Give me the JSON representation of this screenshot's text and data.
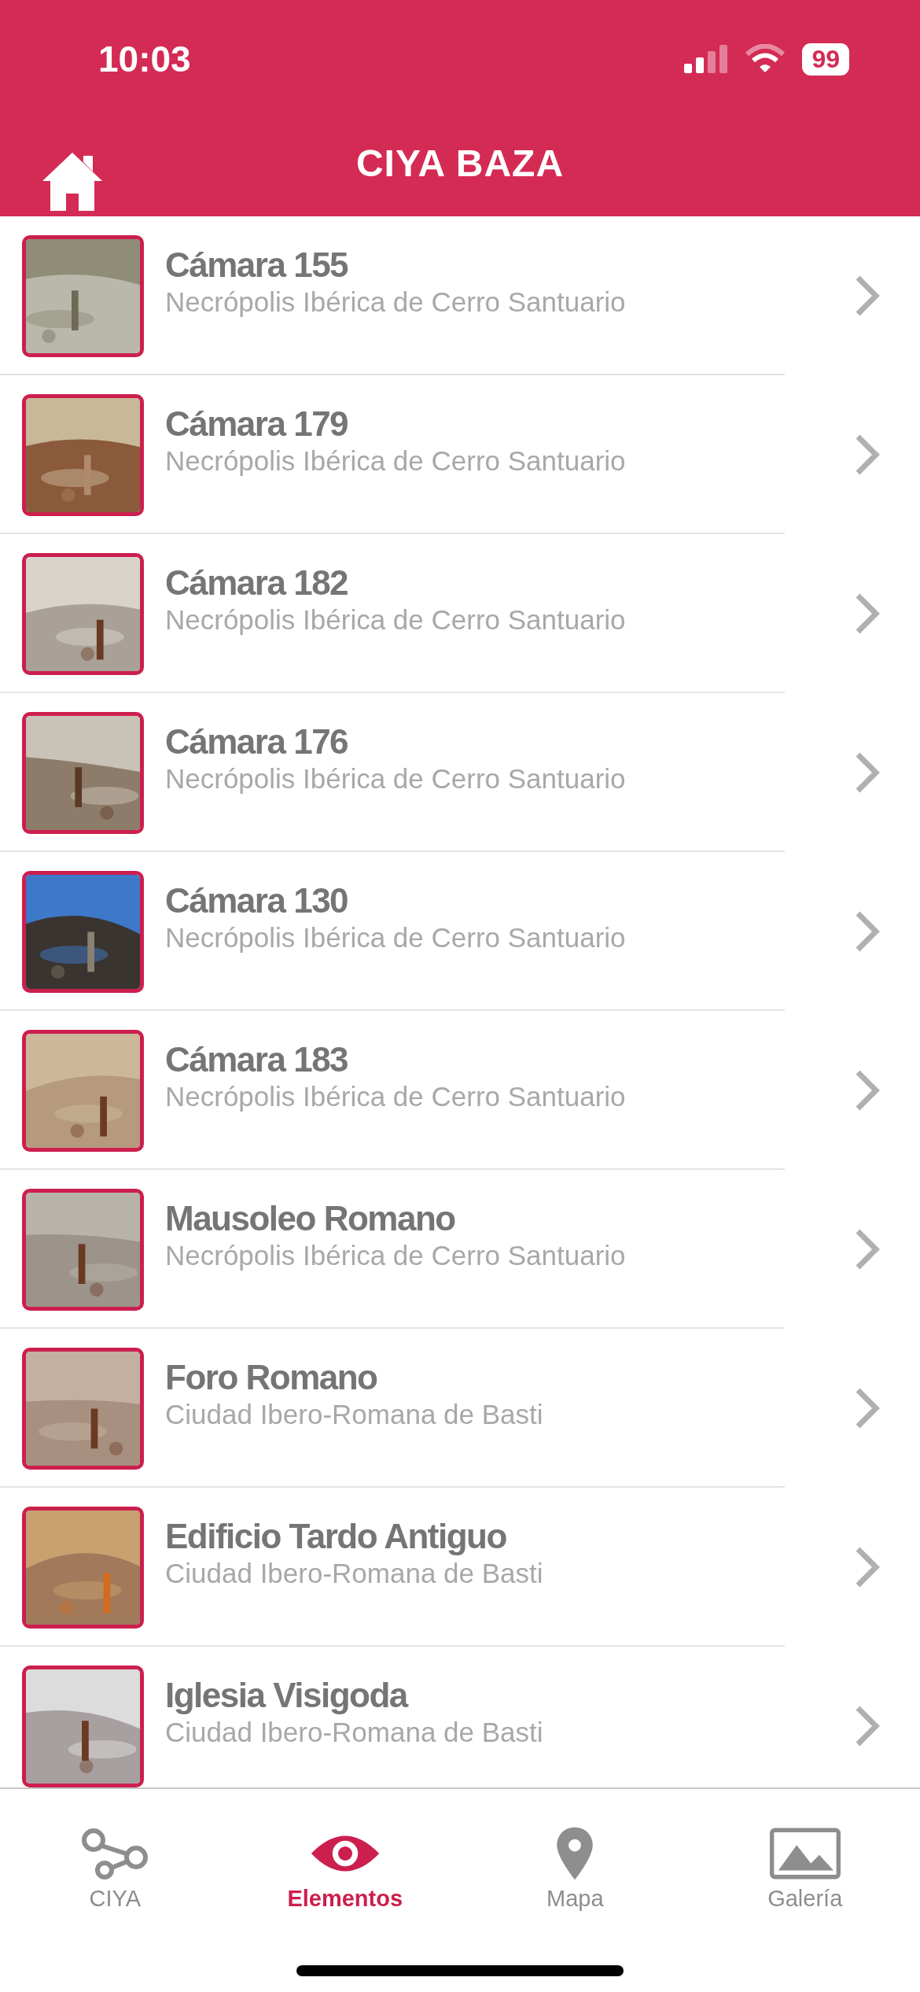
{
  "status_bar": {
    "time": "10:03",
    "battery": "99"
  },
  "nav_bar": {
    "title": "CIYA BAZA"
  },
  "items": [
    {
      "title": "Cámara 155",
      "subtitle": "Necrópolis Ibérica de Cerro Santuario"
    },
    {
      "title": "Cámara 179",
      "subtitle": "Necrópolis Ibérica de Cerro Santuario"
    },
    {
      "title": "Cámara 182",
      "subtitle": "Necrópolis Ibérica de Cerro Santuario"
    },
    {
      "title": "Cámara 176",
      "subtitle": "Necrópolis Ibérica de Cerro Santuario"
    },
    {
      "title": "Cámara 130",
      "subtitle": "Necrópolis Ibérica de Cerro Santuario"
    },
    {
      "title": "Cámara 183",
      "subtitle": "Necrópolis Ibérica de Cerro Santuario"
    },
    {
      "title": "Mausoleo Romano",
      "subtitle": "Necrópolis Ibérica de Cerro Santuario"
    },
    {
      "title": "Foro Romano",
      "subtitle": "Ciudad Ibero-Romana de Basti"
    },
    {
      "title": "Edificio Tardo Antiguo",
      "subtitle": "Ciudad Ibero-Romana de Basti"
    },
    {
      "title": "Iglesia Visigoda",
      "subtitle": "Ciudad Ibero-Romana de Basti"
    }
  ],
  "tab_bar": [
    {
      "label": "CIYA",
      "selected": false
    },
    {
      "label": "Elementos",
      "selected": true
    },
    {
      "label": "Mapa",
      "selected": false
    },
    {
      "label": "Galería",
      "selected": false
    }
  ]
}
